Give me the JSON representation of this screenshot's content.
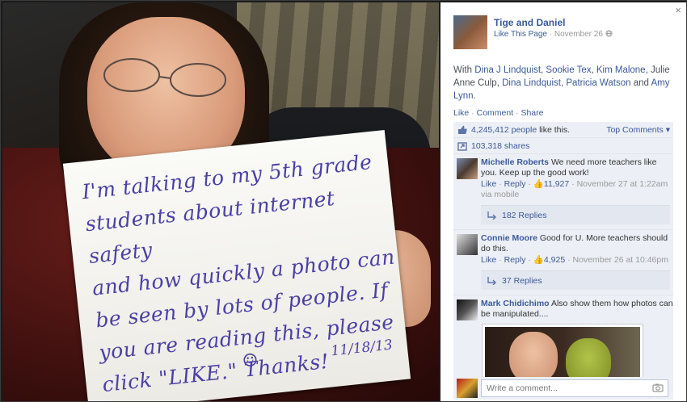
{
  "photo": {
    "sign_lines": [
      "I'm talking to my 5th grade",
      "students about internet safety",
      "and how quickly a photo can",
      "be seen by lots of people. If",
      "you are reading this, please",
      "click \"LIKE.\" Thanks!"
    ],
    "sign_date": "11/18/13",
    "sign_smile": "☺"
  },
  "panel": {
    "close_icon": "×",
    "page_name": "Tige and Daniel",
    "like_page": "Like This Page",
    "post_date": " · November 26 ",
    "with_prefix": "With ",
    "tagged": [
      "Dina J Lindquist",
      "Sookie Tex",
      "Kim Malone",
      "Julie Anne Culp",
      "Dina Lindquist",
      "Patricia Watson",
      "Amy Lynn"
    ],
    "actions": {
      "like": "Like",
      "comment": "Comment",
      "share": "Share"
    },
    "likes_count": "4,245,412 people",
    "likes_suffix": " like this.",
    "top_comments": "Top Comments ▾",
    "shares": "103,318 shares",
    "comments": [
      {
        "author": "Michelle Roberts",
        "text": " We need more teachers like you. Keep up the good work!",
        "like": "Like",
        "reply": "Reply",
        "likes": "11,927",
        "time": " · November 27 at 1:22am via mobile",
        "replies": "182 Replies"
      },
      {
        "author": "Connie Moore",
        "text": " Good for U. More teachers should do this.",
        "like": "Like",
        "reply": "Reply",
        "likes": "4,925",
        "time": " · November 26 at 10:46pm",
        "replies": "37 Replies"
      },
      {
        "author": "Mark Chidichimo",
        "text": " Also show them how photos can be manipulated...."
      }
    ],
    "write_placeholder": "Write a comment..."
  },
  "colors": {
    "link": "#3b5998",
    "panel_bg": "#eceff5",
    "ink": "#4a3fa6"
  }
}
